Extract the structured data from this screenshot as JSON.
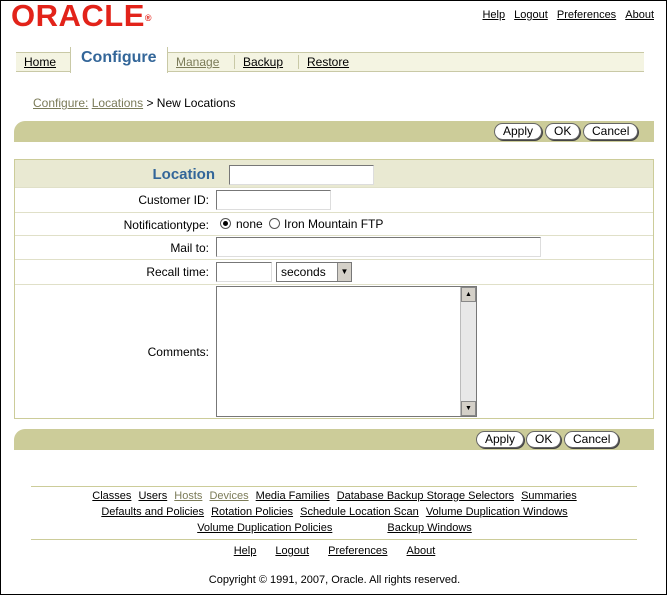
{
  "header": {
    "logo": "ORACLE",
    "links": [
      "Help",
      "Logout",
      "Preferences",
      "About"
    ]
  },
  "tabs": {
    "home": "Home",
    "configure": "Configure",
    "manage": "Manage",
    "backup": "Backup",
    "restore": "Restore"
  },
  "breadcrumb": {
    "configure": "Configure:",
    "locations": "Locations",
    "separator": ">",
    "current": "New Locations"
  },
  "buttons": {
    "apply": "Apply",
    "ok": "OK",
    "cancel": "Cancel"
  },
  "form": {
    "location_label": "Location",
    "location_value": "",
    "customer_id_label": "Customer ID:",
    "customer_id_value": "",
    "notification_label": "Notificationtype:",
    "notification_options": [
      "none",
      "Iron Mountain FTP"
    ],
    "notification_selected": "none",
    "mail_to_label": "Mail to:",
    "mail_to_value": "",
    "recall_time_label": "Recall time:",
    "recall_time_value": "",
    "recall_unit": "seconds",
    "comments_label": "Comments:"
  },
  "footer": {
    "row1": [
      "Classes",
      "Users",
      "Hosts",
      "Devices",
      "Media Families",
      "Database Backup Storage Selectors",
      "Summaries"
    ],
    "row2": [
      "Defaults and Policies",
      "Rotation Policies",
      "Schedule Location Scan",
      "Volume Duplication Windows"
    ],
    "row3": [
      "Volume Duplication Policies",
      "Backup Windows"
    ],
    "global": [
      "Help",
      "Logout",
      "Preferences",
      "About"
    ],
    "copyright": "Copyright © 1991, 2007, Oracle. All rights reserved."
  }
}
